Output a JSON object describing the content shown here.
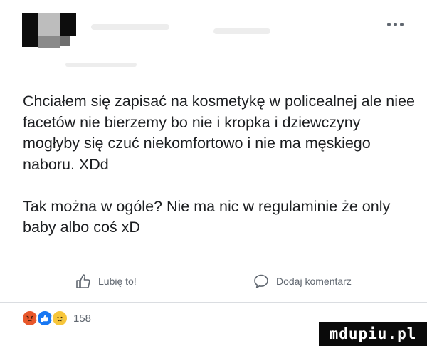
{
  "post": {
    "author_name": "",
    "text": "Chciałem się zapisać na kosmetykę w policealnej ale niee facetów nie bierzemy bo nie i kropka i dziewczyny mogłyby się czuć niekomfortowo i nie ma męskiego naboru. XDd\n\nTak można w ogóle? Nie ma nic w regulaminie że only baby albo coś xD"
  },
  "actions": {
    "like_label": "Lubię to!",
    "comment_label": "Dodaj komentarz"
  },
  "reactions": {
    "types": [
      "angry",
      "like",
      "sad"
    ],
    "count": "158"
  },
  "watermark": "mdupiu.pl",
  "icons": {
    "more": "more-options-icon",
    "like": "thumbs-up-icon",
    "comment": "comment-bubble-icon"
  },
  "colors": {
    "text": "#1c1e21",
    "secondary_text": "#606770",
    "like_blue": "#1877f2",
    "angry": "#e8582c",
    "sad": "#f7c63b"
  }
}
